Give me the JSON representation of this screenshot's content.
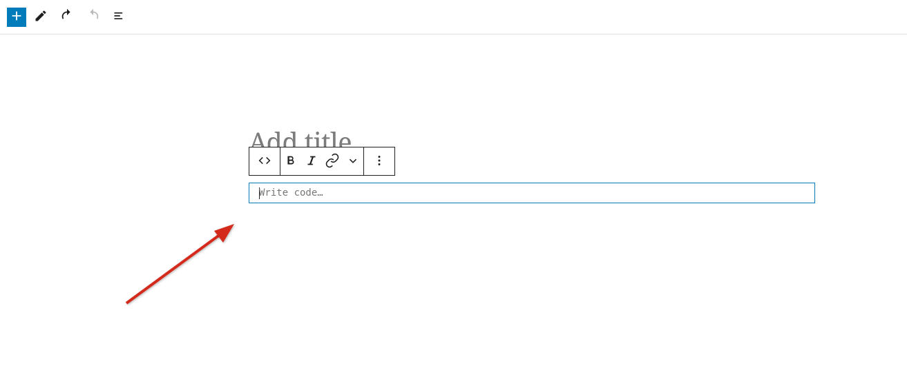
{
  "title_placeholder": "Add title",
  "code_placeholder": "Write code…",
  "icons": {
    "plus": "plus",
    "edit": "edit",
    "undo": "undo",
    "redo": "redo",
    "content": "content",
    "code": "code",
    "bold": "bold",
    "italic": "italic",
    "link": "link",
    "more_down": "chevron-down",
    "more_v": "more-vertical"
  },
  "colors": {
    "primary": "#007cba",
    "border_dark": "#1e1e1e",
    "placeholder": "#767676",
    "title_placeholder": "#7b7b7b",
    "annotation": "#d4291c"
  }
}
